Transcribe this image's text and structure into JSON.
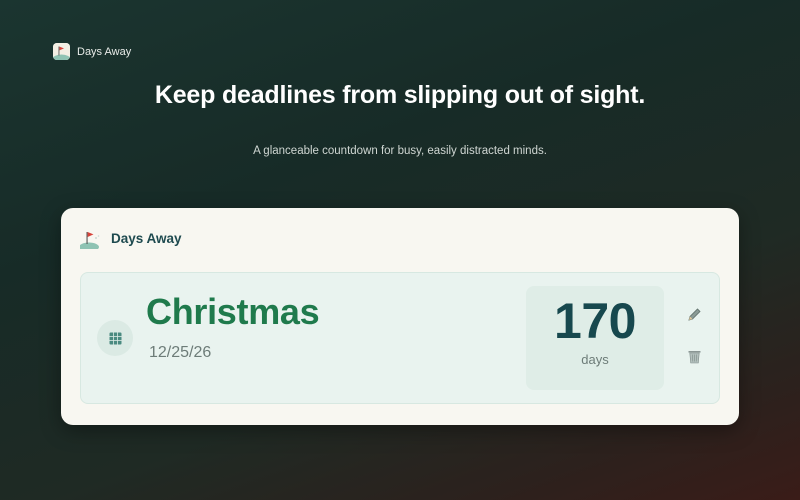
{
  "app": {
    "name": "Days Away",
    "icon": "flag-on-hill-icon"
  },
  "hero": {
    "headline": "Keep deadlines from slipping out of sight.",
    "subline": "A glanceable countdown for busy, easily distracted minds."
  },
  "card": {
    "title": "Days Away",
    "icon": "flag-on-hill-icon",
    "countdowns": [
      {
        "name": "Christmas",
        "date": "12/25/26",
        "count": "170",
        "unit": "days",
        "icon": "calendar-icon",
        "actions": {
          "edit_icon": "pencil-icon",
          "delete_icon": "trash-icon"
        }
      }
    ]
  },
  "colors": {
    "accent_green": "#1f7a4c",
    "count_teal": "#17484e",
    "card_bg": "#f8f7f1",
    "item_bg": "#e9f3ef"
  }
}
